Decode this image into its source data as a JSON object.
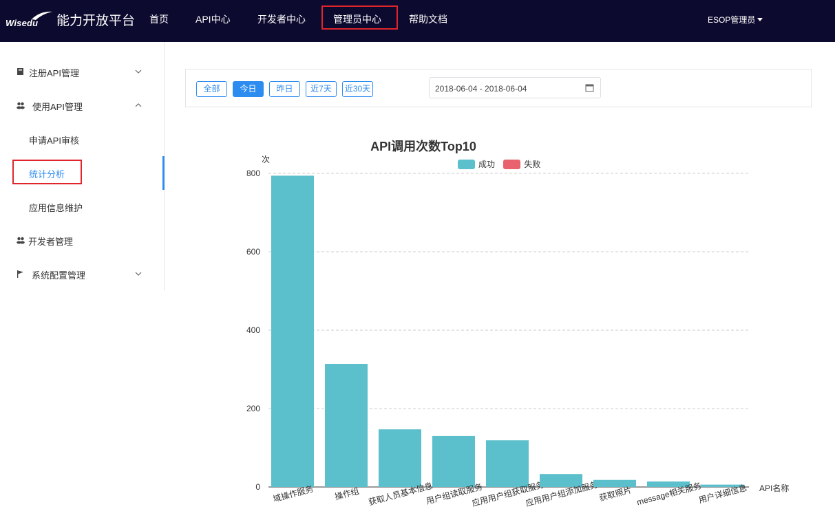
{
  "brand": {
    "logo_text": "Wisedu",
    "title": "能力开放平台"
  },
  "nav": {
    "items": [
      "首页",
      "API中心",
      "开发者中心",
      "管理员中心",
      "帮助文档"
    ],
    "active": "管理员中心",
    "user": "ESOP管理员"
  },
  "sidebar": {
    "items": [
      {
        "label": "注册API管理",
        "icon": "book-icon",
        "expanded": false
      },
      {
        "label": "使用API管理",
        "icon": "users-icon",
        "expanded": true
      },
      {
        "label": "开发者管理",
        "icon": "users-icon"
      },
      {
        "label": "系统配置管理",
        "icon": "flag-icon",
        "expanded": false
      }
    ],
    "sub_items": [
      "申请API审核",
      "统计分析",
      "应用信息维护"
    ],
    "active_sub": "统计分析"
  },
  "filter": {
    "buttons": [
      "全部",
      "今日",
      "昨日",
      "近7天",
      "近30天"
    ],
    "selected": "今日",
    "date_range": "2018-06-04 - 2018-06-04",
    "calendar_icon": "calendar-icon"
  },
  "colors": {
    "nav_bg": "#0c0a2e",
    "accent": "#2d8cf0",
    "success": "#5bbfcc",
    "fail": "#e8636e",
    "highlight": "#e0262b"
  },
  "chart_data": {
    "type": "bar",
    "title": "API调用次数Top10",
    "ylabel": "次",
    "xlabel": "API名称",
    "ylim": [
      0,
      800
    ],
    "yticks": [
      0,
      200,
      400,
      600,
      800
    ],
    "grid": true,
    "legend_position": "top",
    "categories": [
      "域操作服务",
      "操作组",
      "获取人员基本信息",
      "用户组读取服务",
      "应用用户组获取服务",
      "应用用户组添加服务",
      "获取照片",
      "message相关服务",
      "用户详细信息"
    ],
    "series": [
      {
        "name": "成功",
        "color": "#5bbfcc",
        "values": [
          794,
          314,
          147,
          130,
          119,
          33,
          18,
          14,
          6
        ]
      },
      {
        "name": "失败",
        "color": "#e8636e",
        "values": [
          0,
          0,
          0,
          0,
          0,
          0,
          0,
          0,
          0
        ]
      }
    ]
  }
}
